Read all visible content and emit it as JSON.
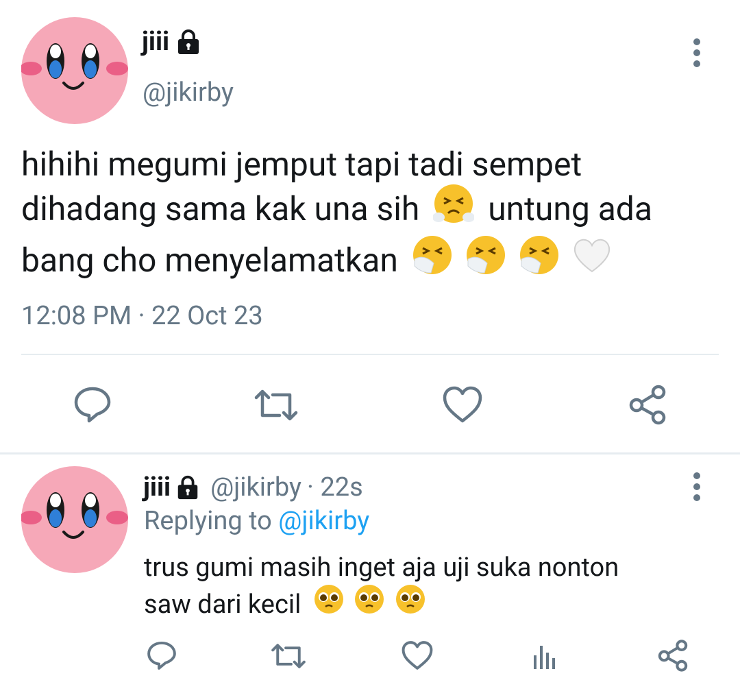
{
  "main_tweet": {
    "display_name": "jiii",
    "handle": "@jikirby",
    "text_lines": [
      "hihihi megumi jemput tapi tadi sempet",
      "dihadang sama kak una sih",
      "untung ada",
      "bang cho menyelamatkan"
    ],
    "timestamp": "12:08 PM · 22 Oct 23",
    "actions": [
      "reply-icon",
      "retweet-icon",
      "like-icon",
      "share-icon"
    ]
  },
  "reply_tweet": {
    "display_name": "jiii",
    "handle": "@jikirby",
    "age": "· 22s",
    "replying_label": "Replying to",
    "replying_handle": "@jikirby",
    "text_lines": [
      "trus gumi masih inget aja uji suka nonton",
      "saw dari kecil"
    ],
    "actions": [
      "reply-icon",
      "retweet-icon",
      "like-icon",
      "analytics-icon",
      "share-icon"
    ]
  },
  "colors": {
    "text": "#14171a",
    "muted": "#657786",
    "link": "#1da1f2",
    "avatar_pink": "#f6a8b8",
    "emoji_yellow": "#f7c12b"
  }
}
